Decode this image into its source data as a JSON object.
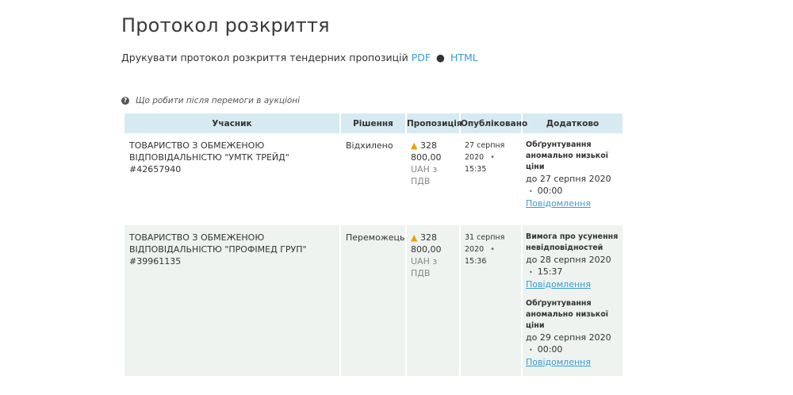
{
  "page": {
    "title": "Протокол розкриття",
    "print_label": "Друкувати протокол розкриття тендерних пропозицій",
    "print_pdf": "PDF",
    "print_separator": "●",
    "print_html": "HTML",
    "help_text": "Що робити після перемоги в аукціоні"
  },
  "table": {
    "headers": [
      "Учасник",
      "Рішення",
      "Пропозиція",
      "Опубліковано",
      "Додатково"
    ],
    "rows": [
      {
        "participant": "ТОВАРИСТВО З ОБМЕЖЕНОЮ ВІДПОВІДАЛЬНІСТЮ \"УМТК ТРЕЙД\" #42657940",
        "decision": "Відхилено",
        "offer_amount": "328 800,00",
        "offer_currency": "UAH з ПДВ",
        "published_date": "27 серпня 2020",
        "published_time": "15:35",
        "extras": [
          {
            "title": "Обґрунтування аномально низької ціни",
            "due": "до 27 серпня 2020",
            "time": "00:00",
            "link": "Повідомлення"
          }
        ]
      },
      {
        "participant": "ТОВАРИСТВО З ОБМЕЖЕНОЮ ВІДПОВІДАЛЬНІСТЮ \"ПРОФІМЕД ГРУП\" #39961135",
        "decision": "Переможець",
        "offer_amount": "328 800,00",
        "offer_currency": "UAH з ПДВ",
        "published_date": "31 серпня 2020",
        "published_time": "15:36",
        "extras": [
          {
            "title": "Вимога про усунення невідповідностей",
            "due": "до 28 серпня 2020",
            "time": "15:37",
            "link": "Повідомлення"
          },
          {
            "title": "Обґрунтування аномально низької ціни",
            "due": "до 29 серпня 2020",
            "time": "00:00",
            "link": "Повідомлення"
          }
        ]
      }
    ]
  },
  "icons": {
    "help": "question-circle-icon",
    "warning": "warning-triangle-icon"
  },
  "colors": {
    "header_bg": "#d6eaf2",
    "row_alt_bg": "#eef3f0",
    "link": "#3a9bd5",
    "warning": "#f0a000"
  }
}
